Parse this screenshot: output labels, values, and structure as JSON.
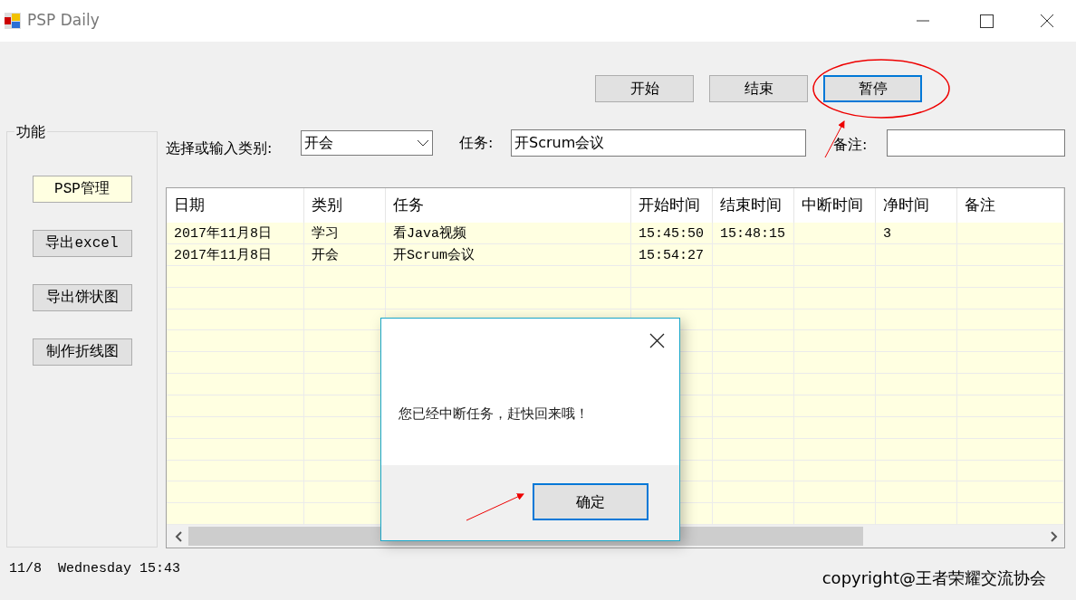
{
  "window": {
    "title": "PSP Daily"
  },
  "top_buttons": [
    {
      "label": "开始",
      "focused": false
    },
    {
      "label": "结束",
      "focused": false
    },
    {
      "label": "暂停",
      "focused": true
    }
  ],
  "sidebar": {
    "title": "功能",
    "items": [
      {
        "label": "PSP管理",
        "selected": true
      },
      {
        "label": "导出excel",
        "selected": false
      },
      {
        "label": "导出饼状图",
        "selected": false
      },
      {
        "label": "制作折线图",
        "selected": false
      }
    ]
  },
  "form": {
    "category_label": "选择或输入类别:",
    "category_value": "开会",
    "task_label": "任务:",
    "task_value": "开Scrum会议",
    "note_label": "备注:"
  },
  "table": {
    "columns": [
      "日期",
      "类别",
      "任务",
      "开始时间",
      "结束时间",
      "中断时间",
      "净时间",
      "备注"
    ],
    "rows": [
      [
        "2017年11月8日",
        "学习",
        "看Java视频",
        "15:45:50",
        "15:48:15",
        "",
        "3",
        ""
      ],
      [
        "2017年11月8日",
        "开会",
        "开Scrum会议",
        "15:54:27",
        "",
        "",
        "",
        ""
      ]
    ]
  },
  "status_bar": {
    "datetime": "11/8  Wednesday 15:43",
    "copyright": "copyright@王者荣耀交流协会"
  },
  "dialog": {
    "message": "您已经中断任务，赶快回来哦！",
    "button": {
      "label": "确定",
      "focused": true
    }
  }
}
